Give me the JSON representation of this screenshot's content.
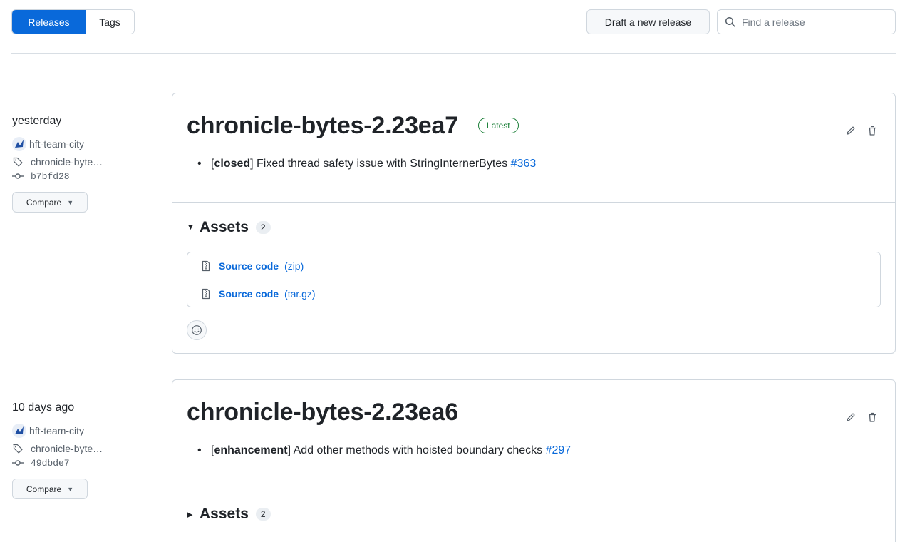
{
  "tabs": [
    {
      "label": "Releases",
      "active": true
    },
    {
      "label": "Tags",
      "active": false
    }
  ],
  "toolbar": {
    "draft_label": "Draft a new release",
    "search_placeholder": "Find a release"
  },
  "releases": [
    {
      "date": "yesterday",
      "author": "hft-team-city",
      "tag": "chronicle-byte…",
      "commit": "b7bfd28",
      "compare_label": "Compare",
      "title": "chronicle-bytes-2.23ea7",
      "badge": "Latest",
      "note": {
        "prefix": "[",
        "label": "closed",
        "suffix": "] Fixed thread safety issue with StringInternerBytes ",
        "issue": "#363"
      },
      "assets_label": "Assets",
      "assets_count": "2",
      "assets_expanded": true,
      "assets": [
        {
          "name": "Source code",
          "ext": "(zip)"
        },
        {
          "name": "Source code",
          "ext": "(tar.gz)"
        }
      ]
    },
    {
      "date": "10 days ago",
      "author": "hft-team-city",
      "tag": "chronicle-byte…",
      "commit": "49dbde7",
      "compare_label": "Compare",
      "title": "chronicle-bytes-2.23ea6",
      "note": {
        "prefix": "[",
        "label": "enhancement",
        "suffix": "] Add other methods with hoisted boundary checks ",
        "issue": "#297"
      },
      "assets_label": "Assets",
      "assets_count": "2",
      "assets_expanded": false
    }
  ],
  "colors": {
    "accent": "#0969da",
    "success": "#1a7f37",
    "border": "#d0d7de"
  }
}
